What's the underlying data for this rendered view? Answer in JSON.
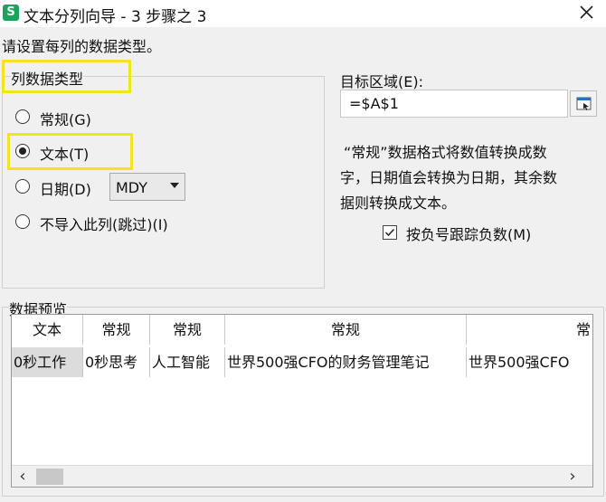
{
  "window": {
    "app_icon_letter": "S",
    "title": "文本分列向导 - 3 步骤之 3",
    "close_glyph": "╳"
  },
  "instruction": "请设置每列的数据类型。",
  "column_type": {
    "legend": "列数据类型",
    "options": [
      {
        "label": "常规(G)",
        "selected": false
      },
      {
        "label": "文本(T)",
        "selected": true
      },
      {
        "label": "日期(D)",
        "selected": false
      },
      {
        "label": "不导入此列(跳过)(I)",
        "selected": false
      }
    ],
    "date_format": "MDY"
  },
  "destination": {
    "label": "目标区域(E):",
    "value": "=$A$1",
    "picker_icon": "range-picker-icon"
  },
  "description": [
    "“常规”数据格式将数值转换成数",
    "字，日期值会转换为日期，其余数",
    "据则转换成文本。"
  ],
  "negative_checkbox": {
    "label": "按负号跟踪负数(M)",
    "checked": true
  },
  "preview": {
    "label": "数据预览",
    "headers": [
      "文本",
      "常规",
      "常规",
      "常规",
      "常"
    ],
    "row": [
      "0秒工作",
      "0秒思考",
      "人工智能",
      "世界500强CFO的财务管理笔记",
      "世界500强CFO"
    ]
  },
  "colors": {
    "highlight": "#f2e51f",
    "app_icon": "#1aa35b"
  }
}
